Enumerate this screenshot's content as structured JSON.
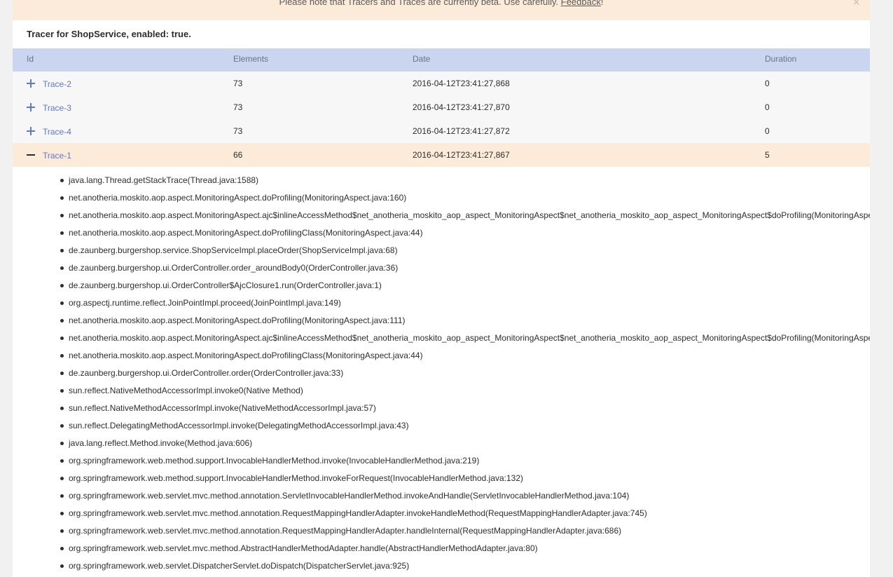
{
  "notice": {
    "text": "Please note that Tracers and Traces are currently beta. Use carefully.",
    "link_label": "Feedback",
    "trailing": "!",
    "close_glyph": "×"
  },
  "tracer": {
    "title": "Tracer for ShopService, enabled: true."
  },
  "table": {
    "headers": {
      "id": "Id",
      "elements": "Elements",
      "date": "Date",
      "duration": "Duration"
    },
    "rows": [
      {
        "id": "Trace-2",
        "elements": "73",
        "date": "2016-04-12T23:41:27,868",
        "duration": "0",
        "expanded": false
      },
      {
        "id": "Trace-3",
        "elements": "73",
        "date": "2016-04-12T23:41:27,870",
        "duration": "0",
        "expanded": false
      },
      {
        "id": "Trace-4",
        "elements": "73",
        "date": "2016-04-12T23:41:27,872",
        "duration": "0",
        "expanded": false
      },
      {
        "id": "Trace-1",
        "elements": "66",
        "date": "2016-04-12T23:41:27,867",
        "duration": "5",
        "expanded": true
      }
    ]
  },
  "stacktrace": [
    "java.lang.Thread.getStackTrace(Thread.java:1588)",
    "net.anotheria.moskito.aop.aspect.MonitoringAspect.doProfiling(MonitoringAspect.java:160)",
    "net.anotheria.moskito.aop.aspect.MonitoringAspect.ajc$inlineAccessMethod$net_anotheria_moskito_aop_aspect_MonitoringAspect$net_anotheria_moskito_aop_aspect_MonitoringAspect$doProfiling(MonitoringAspe",
    "net.anotheria.moskito.aop.aspect.MonitoringAspect.doProfilingClass(MonitoringAspect.java:44)",
    "de.zaunberg.burgershop.service.ShopServiceImpl.placeOrder(ShopServiceImpl.java:68)",
    "de.zaunberg.burgershop.ui.OrderController.order_aroundBody0(OrderController.java:36)",
    "de.zaunberg.burgershop.ui.OrderController$AjcClosure1.run(OrderController.java:1)",
    "org.aspectj.runtime.reflect.JoinPointImpl.proceed(JoinPointImpl.java:149)",
    "net.anotheria.moskito.aop.aspect.MonitoringAspect.doProfiling(MonitoringAspect.java:111)",
    "net.anotheria.moskito.aop.aspect.MonitoringAspect.ajc$inlineAccessMethod$net_anotheria_moskito_aop_aspect_MonitoringAspect$net_anotheria_moskito_aop_aspect_MonitoringAspect$doProfiling(MonitoringAspe",
    "net.anotheria.moskito.aop.aspect.MonitoringAspect.doProfilingClass(MonitoringAspect.java:44)",
    "de.zaunberg.burgershop.ui.OrderController.order(OrderController.java:33)",
    "sun.reflect.NativeMethodAccessorImpl.invoke0(Native Method)",
    "sun.reflect.NativeMethodAccessorImpl.invoke(NativeMethodAccessorImpl.java:57)",
    "sun.reflect.DelegatingMethodAccessorImpl.invoke(DelegatingMethodAccessorImpl.java:43)",
    "java.lang.reflect.Method.invoke(Method.java:606)",
    "org.springframework.web.method.support.InvocableHandlerMethod.invoke(InvocableHandlerMethod.java:219)",
    "org.springframework.web.method.support.InvocableHandlerMethod.invokeForRequest(InvocableHandlerMethod.java:132)",
    "org.springframework.web.servlet.mvc.method.annotation.ServletInvocableHandlerMethod.invokeAndHandle(ServletInvocableHandlerMethod.java:104)",
    "org.springframework.web.servlet.mvc.method.annotation.RequestMappingHandlerAdapter.invokeHandleMethod(RequestMappingHandlerAdapter.java:745)",
    "org.springframework.web.servlet.mvc.method.annotation.RequestMappingHandlerAdapter.handleInternal(RequestMappingHandlerAdapter.java:686)",
    "org.springframework.web.servlet.mvc.method.AbstractHandlerMethodAdapter.handle(AbstractHandlerMethodAdapter.java:80)",
    "org.springframework.web.servlet.DispatcherServlet.doDispatch(DispatcherServlet.java:925)"
  ]
}
